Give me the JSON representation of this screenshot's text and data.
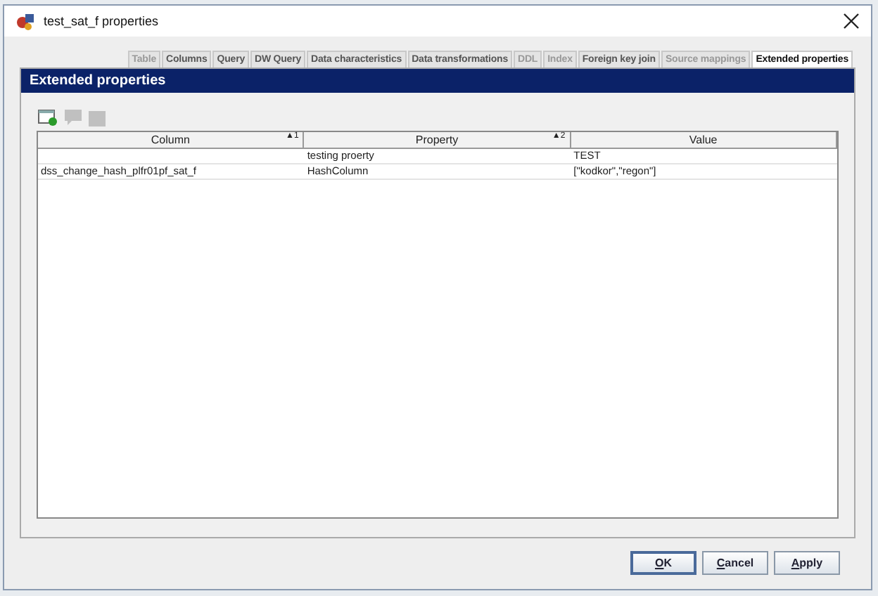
{
  "window": {
    "title": "test_sat_f properties"
  },
  "tabs": [
    {
      "label": "Table",
      "selected": false,
      "disabled": true
    },
    {
      "label": "Columns",
      "selected": false,
      "disabled": false
    },
    {
      "label": "Query",
      "selected": false,
      "disabled": false
    },
    {
      "label": "DW Query",
      "selected": false,
      "disabled": false
    },
    {
      "label": "Data characteristics",
      "selected": false,
      "disabled": false
    },
    {
      "label": "Data transformations",
      "selected": false,
      "disabled": false
    },
    {
      "label": "DDL",
      "selected": false,
      "disabled": true
    },
    {
      "label": "Index",
      "selected": false,
      "disabled": true
    },
    {
      "label": "Foreign key join",
      "selected": false,
      "disabled": false
    },
    {
      "label": "Source mappings",
      "selected": false,
      "disabled": true
    },
    {
      "label": "Extended properties",
      "selected": true,
      "disabled": false
    }
  ],
  "panel": {
    "title": "Extended properties"
  },
  "toolbar": [
    {
      "kind": "add",
      "disabled": false
    },
    {
      "kind": "edit",
      "disabled": true
    },
    {
      "kind": "delete",
      "disabled": true
    }
  ],
  "table": {
    "columns": [
      {
        "label": "Column",
        "sort": "▲1"
      },
      {
        "label": "Property",
        "sort": "▲2"
      },
      {
        "label": "Value"
      }
    ],
    "rows": [
      [
        "",
        "testing proerty",
        "TEST"
      ],
      [
        "dss_change_hash_plfr01pf_sat_f",
        "HashColumn",
        "[\"kodkor\",\"regon\"]"
      ]
    ]
  },
  "buttons": [
    {
      "label": "OK",
      "default": true
    },
    {
      "label": "Cancel",
      "default": false
    },
    {
      "label": "Apply",
      "default": false
    }
  ]
}
